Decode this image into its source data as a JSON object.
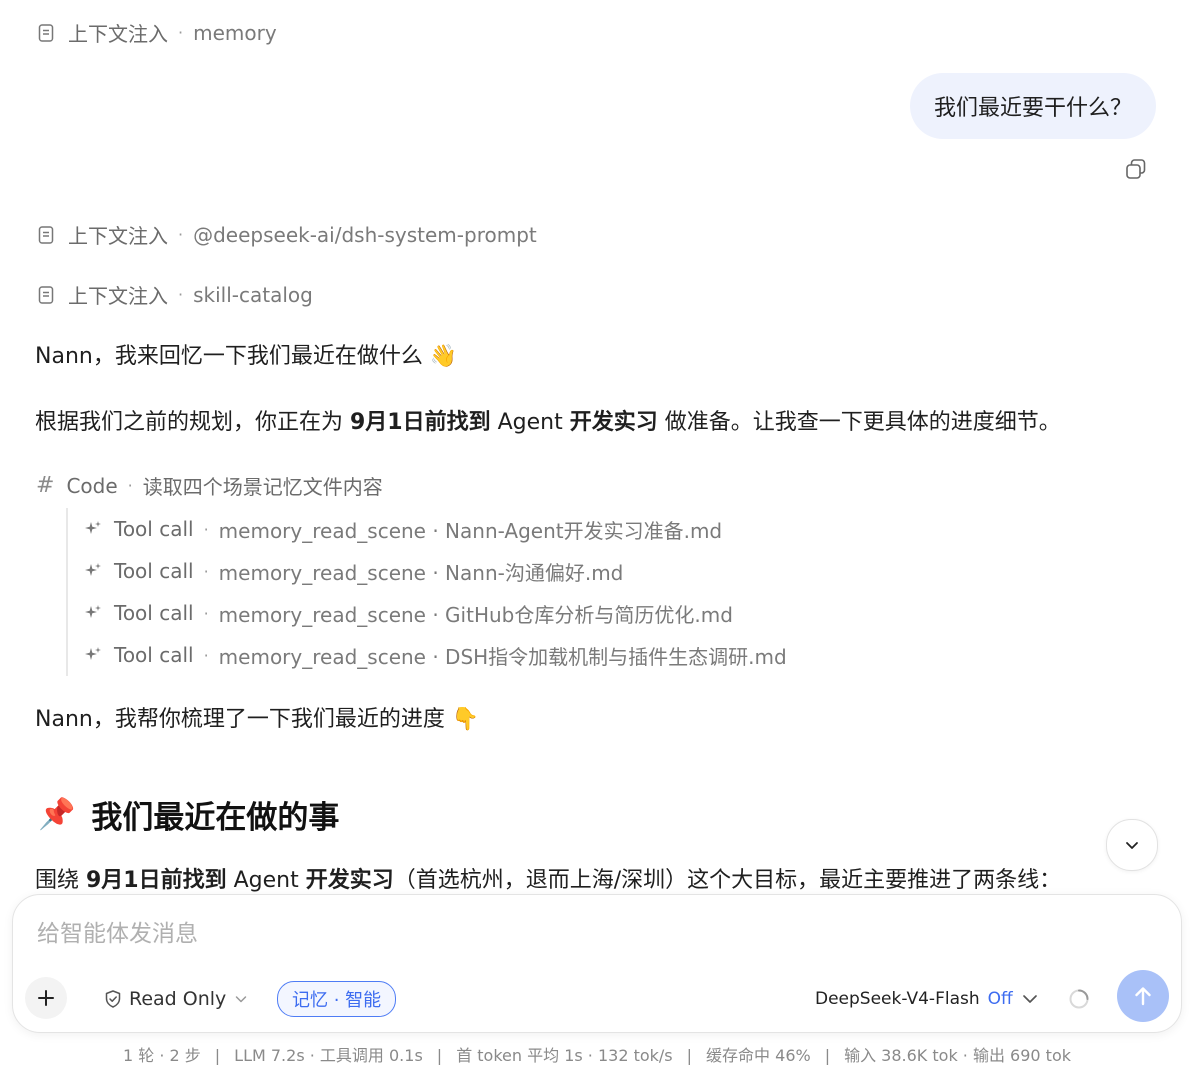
{
  "context_rows": [
    {
      "label": "上下文注入",
      "detail": "memory"
    },
    {
      "label": "上下文注入",
      "detail": "@deepseek-ai/dsh-system-prompt"
    },
    {
      "label": "上下文注入",
      "detail": "skill-catalog"
    }
  ],
  "user_message": "我们最近要干什么？",
  "assistant": {
    "greeting": "Nann，我来回忆一下我们最近在做什么 👋",
    "plan_prefix": "根据我们之前的规划，你正在为 ",
    "plan_bold1": "9月1日前找到",
    "plan_mid": " Agent ",
    "plan_bold2": "开发实习",
    "plan_suffix": " 做准备。让我查一下更具体的进度细节。",
    "code_block": {
      "label": "Code",
      "detail": "读取四个场景记忆文件内容"
    },
    "tool_calls": [
      {
        "label": "Tool call",
        "detail": "memory_read_scene · Nann-Agent开发实习准备.md"
      },
      {
        "label": "Tool call",
        "detail": "memory_read_scene · Nann-沟通偏好.md"
      },
      {
        "label": "Tool call",
        "detail": "memory_read_scene · GitHub仓库分析与简历优化.md"
      },
      {
        "label": "Tool call",
        "detail": "memory_read_scene · DSH指令加载机制与插件生态调研.md"
      }
    ],
    "summary": "Nann，我帮你梳理了一下我们最近的进度 👇",
    "heading_emoji": "📌",
    "heading": "我们最近在做的事",
    "last_prefix": "围绕 ",
    "last_bold1": "9月1日前找到",
    "last_mid": " Agent ",
    "last_bold2": "开发实习",
    "last_suffix": "（首选杭州，退而上海/深圳）这个大目标，最近主要推进了两条线："
  },
  "composer": {
    "placeholder": "给智能体发消息",
    "mode": "Read Only",
    "memory_chip": "记忆 · 智能",
    "model": "DeepSeek-V4-Flash",
    "thinking": "Off"
  },
  "stats": [
    "1 轮 · 2 步",
    "LLM 7.2s · 工具调用 0.1s",
    "首 token 平均 1s · 132 tok/s",
    "缓存命中 46%",
    "输入 38.6K tok · 输出 690 tok"
  ],
  "colors": {
    "accent": "#3d6cf0",
    "bubble": "#eef2fd",
    "send": "#a9c1f8"
  }
}
